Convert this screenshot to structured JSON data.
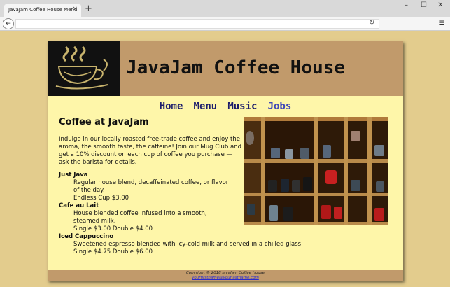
{
  "browser": {
    "tab_title": "JavaJam Coffee House Menu",
    "tab_close": "×",
    "new_tab": "+",
    "minimize": "–",
    "maximize": "☐",
    "close": "✕",
    "back": "←",
    "reload": "↻",
    "menu": "≡"
  },
  "site": {
    "title": "JavaJam Coffee House",
    "nav": [
      "Home",
      "Menu",
      "Music",
      "Jobs"
    ],
    "heading": "Coffee at JavaJam",
    "intro": "Indulge in our locally roasted free-trade coffee and enjoy the aroma, the smooth taste, the caffeine! Join our Mug Club and get a 10% discount on each cup of coffee you purchase — ask the barista for details.",
    "items": [
      {
        "name": "Just Java",
        "desc": "Regular house blend, decaffeinated coffee, or flavor of the day.",
        "price": "Endless Cup $3.00"
      },
      {
        "name": "Cafe au Lait",
        "desc": "House blended coffee infused into a smooth, steamed milk.",
        "price": "Single $3.00 Double $4.00"
      },
      {
        "name": "Iced Cappuccino",
        "desc": "Sweetened espresso blended with icy-cold milk and served in a chilled glass.",
        "price": "Single $4.75 Double $6.00"
      }
    ],
    "footer_copyright": "Copyright © 2018 JavaJam Coffee House",
    "footer_email": "yourfirstname@yourlastname.com"
  },
  "colors": {
    "page_bg": "#e3cc8d",
    "content_bg": "#fef6a9",
    "header_bg": "#c19a6b",
    "nav_link": "#1d1d6b",
    "nav_active": "#3f48b8"
  }
}
